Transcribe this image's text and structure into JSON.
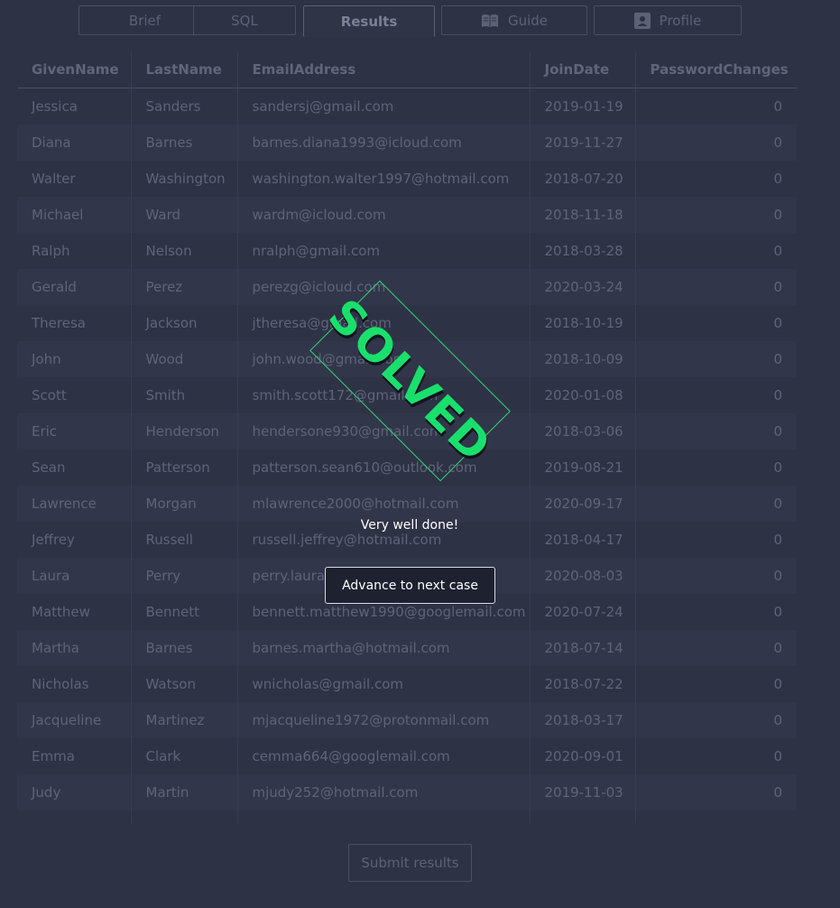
{
  "tabs": [
    {
      "label": "Brief"
    },
    {
      "label": "SQL"
    },
    {
      "label": "Results"
    },
    {
      "label": "Guide",
      "icon": "book-icon"
    },
    {
      "label": "Profile",
      "icon": "profile-icon"
    }
  ],
  "table": {
    "columns": [
      "GivenName",
      "LastName",
      "EmailAddress",
      "JoinDate",
      "PasswordChanges"
    ],
    "rows": [
      [
        "Jessica",
        "Sanders",
        "sandersj@gmail.com",
        "2019-01-19",
        "0"
      ],
      [
        "Diana",
        "Barnes",
        "barnes.diana1993@icloud.com",
        "2019-11-27",
        "0"
      ],
      [
        "Walter",
        "Washington",
        "washington.walter1997@hotmail.com",
        "2018-07-20",
        "0"
      ],
      [
        "Michael",
        "Ward",
        "wardm@icloud.com",
        "2018-11-18",
        "0"
      ],
      [
        "Ralph",
        "Nelson",
        "nralph@gmail.com",
        "2018-03-28",
        "0"
      ],
      [
        "Gerald",
        "Perez",
        "perezg@icloud.com",
        "2020-03-24",
        "0"
      ],
      [
        "Theresa",
        "Jackson",
        "jtheresa@gmail.com",
        "2018-10-19",
        "0"
      ],
      [
        "John",
        "Wood",
        "john.wood@gmail.com",
        "2018-10-09",
        "0"
      ],
      [
        "Scott",
        "Smith",
        "smith.scott172@gmail.com",
        "2020-01-08",
        "0"
      ],
      [
        "Eric",
        "Henderson",
        "hendersone930@gmail.com",
        "2018-03-06",
        "0"
      ],
      [
        "Sean",
        "Patterson",
        "patterson.sean610@outlook.com",
        "2019-08-21",
        "0"
      ],
      [
        "Lawrence",
        "Morgan",
        "mlawrence2000@hotmail.com",
        "2020-09-17",
        "0"
      ],
      [
        "Jeffrey",
        "Russell",
        "russell.jeffrey@hotmail.com",
        "2018-04-17",
        "0"
      ],
      [
        "Laura",
        "Perry",
        "perry.laura@gmail.com",
        "2020-08-03",
        "0"
      ],
      [
        "Matthew",
        "Bennett",
        "bennett.matthew1990@googlemail.com",
        "2020-07-24",
        "0"
      ],
      [
        "Martha",
        "Barnes",
        "barnes.martha@hotmail.com",
        "2018-07-14",
        "0"
      ],
      [
        "Nicholas",
        "Watson",
        "wnicholas@gmail.com",
        "2018-07-22",
        "0"
      ],
      [
        "Jacqueline",
        "Martinez",
        "mjacqueline1972@protonmail.com",
        "2018-03-17",
        "0"
      ],
      [
        "Emma",
        "Clark",
        "cemma664@googlemail.com",
        "2020-09-01",
        "0"
      ],
      [
        "Judy",
        "Martin",
        "mjudy252@hotmail.com",
        "2019-11-03",
        "0"
      ]
    ]
  },
  "overlay": {
    "stamp": "SOLVED",
    "message": "Very well done!",
    "advance_label": "Advance to next case"
  },
  "submit_label": "Submit results",
  "colors": {
    "background": "#2e3245",
    "stamp_green": "#19e06c"
  }
}
